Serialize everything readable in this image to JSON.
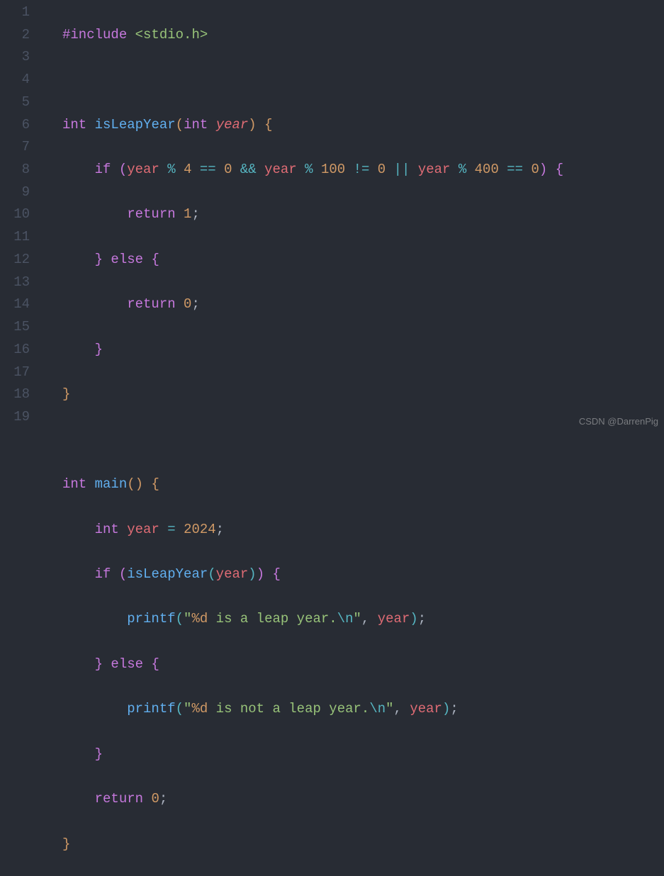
{
  "watermark": "CSDN @DarrenPig",
  "lineNumbers": [
    "1",
    "2",
    "3",
    "4",
    "5",
    "6",
    "7",
    "8",
    "9",
    "10",
    "11",
    "12",
    "13",
    "14",
    "15",
    "16",
    "17",
    "18",
    "19"
  ],
  "code": {
    "include_kw": "#include",
    "include_hdr": "<stdio.h>",
    "int_kw": "int",
    "isLeapYear": "isLeapYear",
    "year": "year",
    "if_kw": "if",
    "else_kw": "else",
    "return_kw": "return",
    "main": "main",
    "printf": "printf",
    "n4": "4",
    "n0": "0",
    "n100": "100",
    "n400": "400",
    "n1": "1",
    "n2024": "2024",
    "op_mod": "%",
    "op_eq": "==",
    "op_ne": "!=",
    "op_and": "&&",
    "op_or": "||",
    "op_assign": "=",
    "str_open": "\"",
    "fmt_d": "%d",
    "str_leap": " is a leap year.",
    "str_not_leap": " is not a leap year.",
    "esc_n": "\\n",
    "str_close": "\"",
    "semi": ";",
    "comma": ",",
    "lbrace": "{",
    "rbrace": "}",
    "lparen": "(",
    "rparen": ")"
  }
}
